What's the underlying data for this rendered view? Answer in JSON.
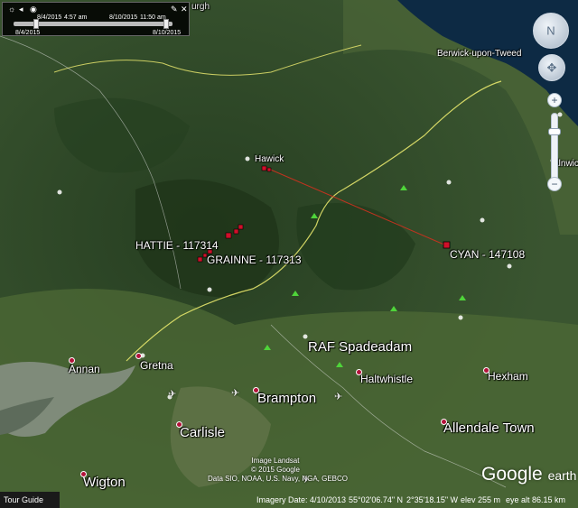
{
  "time_slider": {
    "start_top": "8/4/2015",
    "current_time": "4:57 am",
    "end_top": "8/10/2015",
    "end_time": "11:50 am",
    "start_bottom": "8/4/2015",
    "end_bottom": "8/10/2015"
  },
  "labels": {
    "top_edge_fragment": "urgh",
    "berwick": "Berwick-upon-Tweed",
    "hawick": "Hawick",
    "alnwick_fragment": "Alnwic",
    "hattie": "HATTIE - 117314",
    "grainne": "GRAINNE - 117313",
    "cyan": "CYAN - 147108",
    "raf": "RAF Spadeadam",
    "annan": "Annan",
    "gretna": "Gretna",
    "brampton": "Brampton",
    "haltwhistle": "Haltwhistle",
    "hexham": "Hexham",
    "carlisle": "Carlisle",
    "allendale": "Allendale Town",
    "wigton": "Wigton"
  },
  "credits": {
    "line1": "Image Landsat",
    "line2": "© 2015 Google",
    "line3": "Data SIO, NOAA, U.S. Navy, NGA, GEBCO"
  },
  "logo": {
    "google": "Google",
    "earth": "earth"
  },
  "tour_guide": "Tour Guide",
  "status": {
    "imagery_date": "Imagery Date: 4/10/2013",
    "lat": "55°02'06.74\" N",
    "lon": "2°35'18.15\" W",
    "elev": "elev  255 m",
    "eye_alt": "eye alt  86.15 km"
  },
  "colors": {
    "track_line": "#c0331f",
    "marker": "#d0102a",
    "sea": "#0d2a44",
    "land_dark": "#2d4a26",
    "land_light": "#5b7440",
    "estuary": "#7f8b7a",
    "border_line": "#f0ee70"
  },
  "icons": [
    "sun-icon",
    "play-icon",
    "eye-icon",
    "wrench-icon",
    "close-icon",
    "north-arrow-icon",
    "move-icon",
    "zoom-in-icon",
    "zoom-out-icon",
    "airport-icon",
    "mountain-icon",
    "place-pin-icon"
  ]
}
